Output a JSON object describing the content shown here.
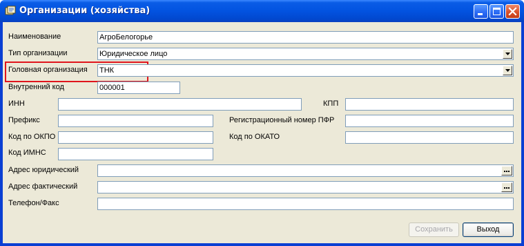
{
  "window": {
    "title": "Организации (хозяйства)",
    "icon": "app-document-icon",
    "controls": [
      "minimize-icon",
      "maximize-icon",
      "close-icon"
    ],
    "colors": {
      "titlebar": "#0253e0",
      "client": "#ece9d8",
      "highlight": "#e0141c"
    }
  },
  "form": {
    "name": {
      "label": "Наименование",
      "value": "АгроБелогорье"
    },
    "org_type": {
      "label": "Тип организации",
      "value": "Юридическое лицо"
    },
    "parent_org": {
      "label": "Головная организация",
      "value": "ТНК"
    },
    "internal_code": {
      "label": "Внутренний код",
      "value": "000001"
    },
    "inn": {
      "label": "ИНН",
      "value": ""
    },
    "kpp": {
      "label": "КПП",
      "value": ""
    },
    "prefix": {
      "label": "Префикс",
      "value": ""
    },
    "pfr_number": {
      "label": "Регистрационный номер ПФР",
      "value": ""
    },
    "okpo": {
      "label": "Код по ОКПО",
      "value": ""
    },
    "okato": {
      "label": "Код по ОКАТО",
      "value": ""
    },
    "imns": {
      "label": "Код ИМНС",
      "value": ""
    },
    "legal_address": {
      "label": "Адрес юридический",
      "value": ""
    },
    "actual_address": {
      "label": "Адрес фактический",
      "value": ""
    },
    "phone_fax": {
      "label": "Телефон/Факс",
      "value": ""
    }
  },
  "buttons": {
    "save": {
      "label": "Сохранить",
      "enabled": false
    },
    "exit": {
      "label": "Выход",
      "enabled": true
    }
  }
}
